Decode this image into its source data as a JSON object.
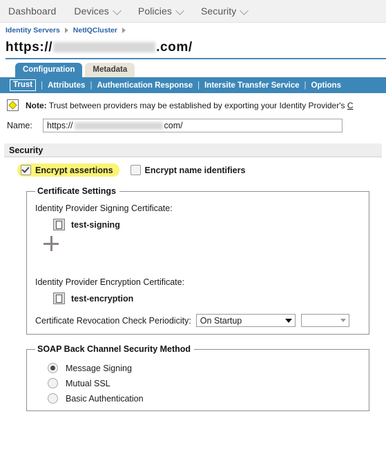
{
  "topnav": {
    "items": [
      {
        "label": "Dashboard",
        "caret": false
      },
      {
        "label": "Devices",
        "caret": true
      },
      {
        "label": "Policies",
        "caret": true
      },
      {
        "label": "Security",
        "caret": true
      }
    ]
  },
  "breadcrumb": {
    "items": [
      {
        "label": "Identity Servers"
      },
      {
        "label": "NetIQCluster"
      }
    ]
  },
  "page": {
    "title_prefix": "https://",
    "title_suffix": ".com/"
  },
  "tabs": [
    {
      "label": "Configuration",
      "active": true
    },
    {
      "label": "Metadata",
      "active": false
    }
  ],
  "subnav": {
    "items": [
      {
        "label": "Trust",
        "selected": true
      },
      {
        "label": "Attributes",
        "selected": false
      },
      {
        "label": "Authentication Response",
        "selected": false
      },
      {
        "label": "Intersite Transfer Service",
        "selected": false
      },
      {
        "label": "Options",
        "selected": false
      }
    ],
    "separator": "|"
  },
  "note": {
    "prefix": "Note:",
    "text": " Trust between providers may be established by exporting your Identity Provider's ",
    "link_text": "C"
  },
  "name_field": {
    "label": "Name:",
    "value_prefix": "https://",
    "value_suffix": "com/"
  },
  "security_section": {
    "title": "Security",
    "encrypt_assertions": {
      "label": "Encrypt assertions",
      "checked": true,
      "highlighted": true
    },
    "encrypt_name_identifiers": {
      "label": "Encrypt name identifiers",
      "checked": false
    }
  },
  "certificate_settings": {
    "legend": "Certificate Settings",
    "signing_label": "Identity Provider Signing Certificate:",
    "signing_cert": "test-signing",
    "add_button": "+",
    "encryption_label": "Identity Provider Encryption Certificate:",
    "encryption_cert": "test-encryption",
    "revocation_label": "Certificate Revocation Check Periodicity:",
    "revocation_value": "On Startup",
    "revocation_secondary_value": ""
  },
  "soap_section": {
    "legend": "SOAP Back Channel Security Method",
    "options": [
      {
        "label": "Message Signing",
        "selected": true
      },
      {
        "label": "Mutual SSL",
        "selected": false
      },
      {
        "label": "Basic Authentication",
        "selected": false
      }
    ]
  },
  "colors": {
    "accent_blue": "#3d87b8",
    "link_blue": "#2a62a8",
    "highlight_yellow": "#fbf474",
    "nav_bg": "#f1f1f1",
    "tab_inactive": "#e9e4d8"
  }
}
